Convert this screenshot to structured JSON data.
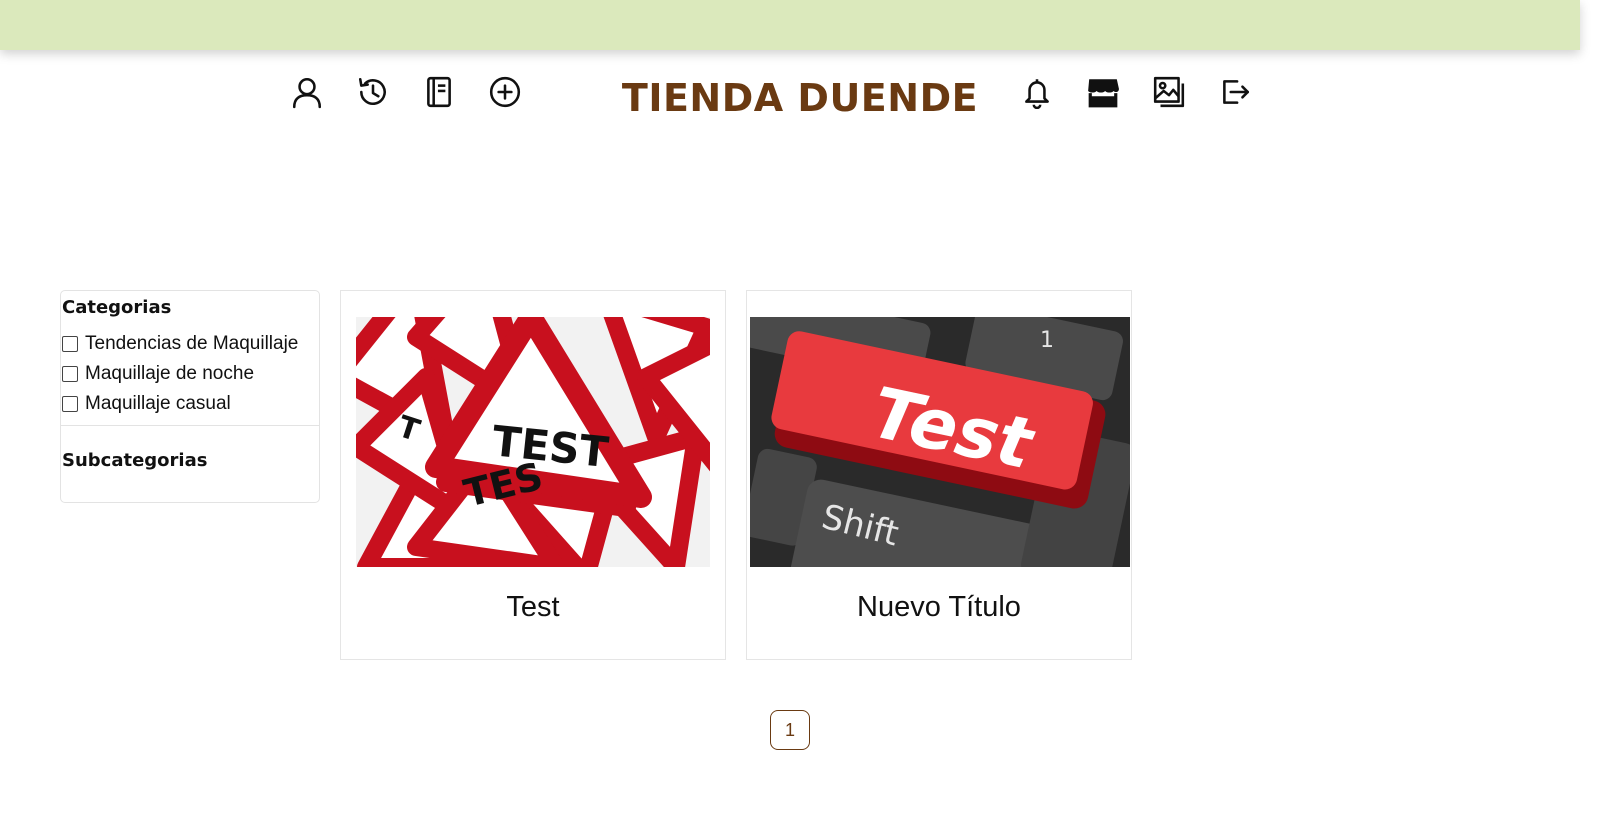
{
  "header": {
    "brand": "TIENDA DUENDE",
    "left_icons": [
      "user-icon",
      "history-icon",
      "notebook-icon",
      "add-circle-icon"
    ],
    "right_icons": [
      "bell-icon",
      "store-icon",
      "images-icon",
      "logout-icon"
    ]
  },
  "filters": {
    "categories_title": "Categorias",
    "categories": [
      {
        "label": "Tendencias de Maquillaje",
        "checked": false
      },
      {
        "label": "Maquillaje de noche",
        "checked": false
      },
      {
        "label": "Maquillaje casual",
        "checked": false
      }
    ],
    "subcategories_title": "Subcategorias"
  },
  "cards": [
    {
      "title": "Test",
      "image": "test-warning-signs-image",
      "image_text": [
        "TEST",
        "TES"
      ]
    },
    {
      "title": "Nuevo Título",
      "image": "test-keyboard-key-image",
      "image_text": [
        "Test",
        "Shift"
      ]
    }
  ],
  "pagination": {
    "current": "1"
  },
  "colors": {
    "topbar": "#dbe9bc",
    "brand": "#6a3a12",
    "accent_red": "#c8101e"
  }
}
